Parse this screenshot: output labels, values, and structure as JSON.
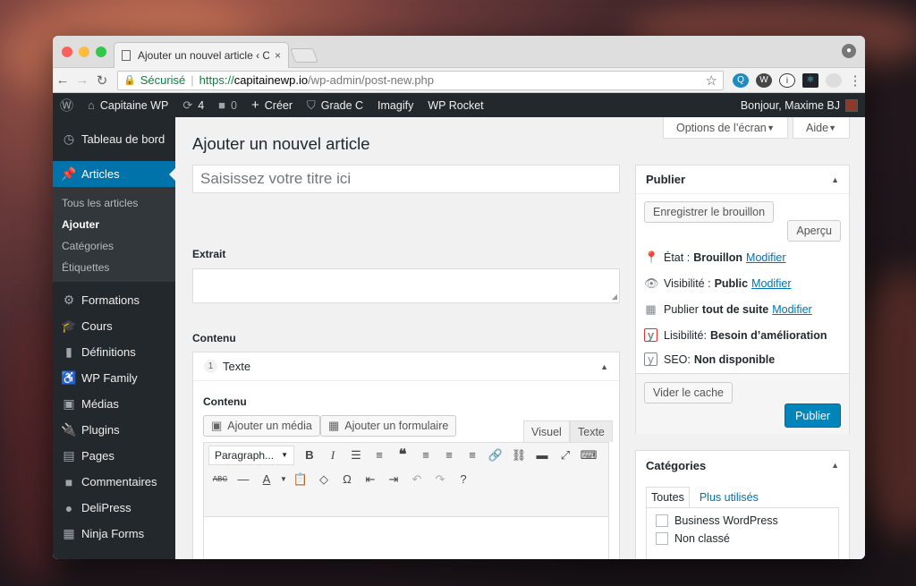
{
  "browser": {
    "tab_title": "Ajouter un nouvel article ‹ Capitaine WP",
    "tab_close": "×",
    "url_secure_label": "Sécurisé",
    "url_scheme": "https://",
    "url_host": "capitainewp.io",
    "url_path": "/wp-admin/post-new.php"
  },
  "adminbar": {
    "site_name": "Capitaine WP",
    "updates_count": "4",
    "comments_count": "0",
    "new_label": "Créer",
    "grade_label": "Grade C",
    "imagify_label": "Imagify",
    "rocket_label": "WP Rocket",
    "greeting": "Bonjour, Maxime BJ"
  },
  "sidebar": {
    "dashboard": "Tableau de bord",
    "articles": "Articles",
    "sub": [
      "Tous les articles",
      "Ajouter",
      "Catégories",
      "Étiquettes"
    ],
    "items": [
      "Formations",
      "Cours",
      "Définitions",
      "WP Family",
      "Médias",
      "Plugins",
      "Pages",
      "Commentaires",
      "DeliPress",
      "Ninja Forms"
    ]
  },
  "main": {
    "screen_options": "Options de l’écran",
    "help": "Aide",
    "page_title": "Ajouter un nouvel article",
    "title_placeholder": "Saisissez votre titre ici",
    "excerpt_label": "Extrait",
    "content_label": "Contenu",
    "block_number": "1",
    "block_type": "Texte",
    "inner_content_label": "Contenu",
    "add_media": "Ajouter un média",
    "add_form": "Ajouter un formulaire",
    "tab_visual": "Visuel",
    "tab_text": "Texte",
    "format_select": "Paragraph..."
  },
  "publish": {
    "title": "Publier",
    "save_draft": "Enregistrer le brouillon",
    "preview": "Aperçu",
    "status_label": "État :",
    "status_value": "Brouillon",
    "visibility_label": "Visibilité :",
    "visibility_value": "Public",
    "publish_label": "Publier",
    "publish_value": "tout de suite",
    "modify": "Modifier",
    "readability_label": "Lisibilité:",
    "readability_value": "Besoin d’amélioration",
    "seo_label": "SEO:",
    "seo_value": "Non disponible",
    "clear_cache": "Vider le cache",
    "publish_button": "Publier"
  },
  "categories": {
    "title": "Catégories",
    "tab_all": "Toutes",
    "tab_popular": "Plus utilisés",
    "items": [
      "Business WordPress",
      "Non classé"
    ]
  }
}
